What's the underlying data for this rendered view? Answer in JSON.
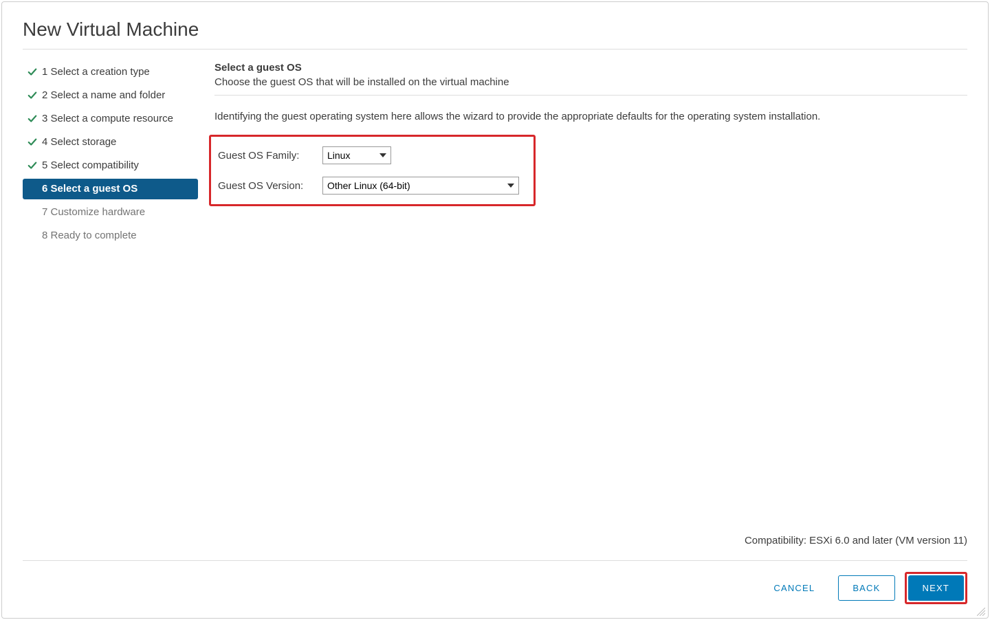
{
  "dialog": {
    "title": "New Virtual Machine"
  },
  "wizard_steps": [
    {
      "label": "1 Select a creation type",
      "state": "completed"
    },
    {
      "label": "2 Select a name and folder",
      "state": "completed"
    },
    {
      "label": "3 Select a compute resource",
      "state": "completed"
    },
    {
      "label": "4 Select storage",
      "state": "completed"
    },
    {
      "label": "5 Select compatibility",
      "state": "completed"
    },
    {
      "label": "6 Select a guest OS",
      "state": "active"
    },
    {
      "label": "7 Customize hardware",
      "state": "pending"
    },
    {
      "label": "8 Ready to complete",
      "state": "pending"
    }
  ],
  "main": {
    "heading": "Select a guest OS",
    "subheading": "Choose the guest OS that will be installed on the virtual machine",
    "description": "Identifying the guest operating system here allows the wizard to provide the appropriate defaults for the operating system installation.",
    "family_label": "Guest OS Family:",
    "version_label": "Guest OS Version:",
    "family_value": "Linux",
    "version_value": "Other Linux (64-bit)"
  },
  "footer": {
    "compatibility": "Compatibility: ESXi 6.0 and later (VM version 11)",
    "cancel": "CANCEL",
    "back": "BACK",
    "next": "NEXT"
  }
}
